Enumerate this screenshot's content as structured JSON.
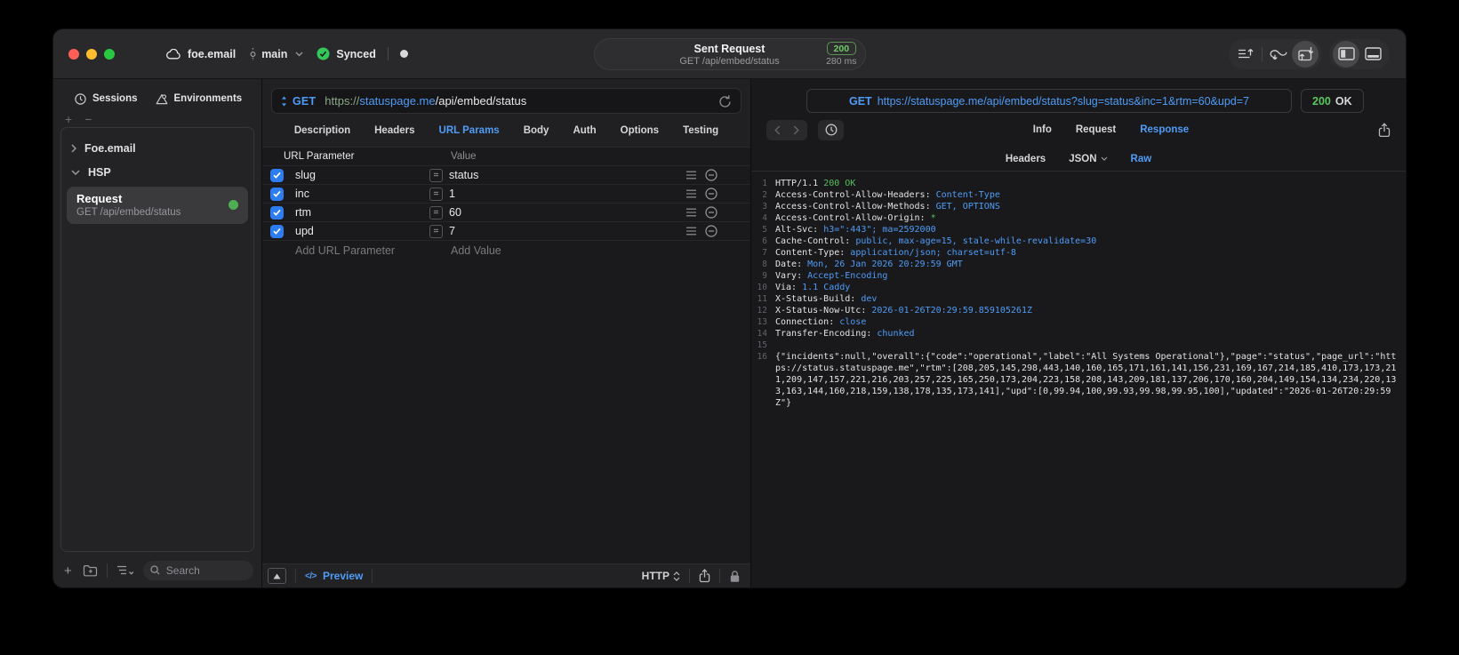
{
  "titlebar": {
    "project": "foe.email",
    "branch": "main",
    "sync_status": "Synced",
    "request": {
      "title": "Sent Request",
      "subtitle": "GET /api/embed/status",
      "status_code": "200",
      "duration": "280 ms"
    }
  },
  "sidebar": {
    "tabs": [
      "Sessions",
      "Environments"
    ],
    "groups": [
      {
        "label": "Foe.email"
      },
      {
        "label": "HSP"
      }
    ],
    "request_item": {
      "title": "Request",
      "subtitle": "GET /api/embed/status"
    },
    "search_placeholder": "Search"
  },
  "request": {
    "method": "GET",
    "url_scheme": "https://",
    "url_host": "statuspage.me",
    "url_path": "/api/embed/status",
    "tabs": [
      "Description",
      "Headers",
      "URL Params",
      "Body",
      "Auth",
      "Options",
      "Testing"
    ],
    "active_tab": "URL Params",
    "params": {
      "columns": [
        "URL Parameter",
        "Value"
      ],
      "rows": [
        {
          "name": "slug",
          "value": "status",
          "enabled": true
        },
        {
          "name": "inc",
          "value": "1",
          "enabled": true
        },
        {
          "name": "rtm",
          "value": "60",
          "enabled": true
        },
        {
          "name": "upd",
          "value": "7",
          "enabled": true
        }
      ],
      "add_name": "Add URL Parameter",
      "add_value": "Add Value"
    },
    "footer": {
      "preview": "Preview",
      "protocol": "HTTP"
    }
  },
  "response": {
    "method": "GET",
    "url": "https://statuspage.me/api/embed/status?slug=status&inc=1&rtm=60&upd=7",
    "status_code": "200",
    "status_text": "OK",
    "tabs": [
      "Info",
      "Request",
      "Response"
    ],
    "active_tab": "Response",
    "subtabs": [
      "Headers",
      "JSON",
      "Raw"
    ],
    "active_subtab": "Raw",
    "lines": [
      {
        "n": 1,
        "parts": [
          {
            "t": "p",
            "s": "HTTP/1.1 "
          },
          {
            "t": "g",
            "s": "200 OK"
          }
        ]
      },
      {
        "n": 2,
        "parts": [
          {
            "t": "p",
            "s": "Access-Control-Allow-Headers: "
          },
          {
            "t": "b",
            "s": "Content-Type"
          }
        ]
      },
      {
        "n": 3,
        "parts": [
          {
            "t": "p",
            "s": "Access-Control-Allow-Methods: "
          },
          {
            "t": "b",
            "s": "GET, OPTIONS"
          }
        ]
      },
      {
        "n": 4,
        "parts": [
          {
            "t": "p",
            "s": "Access-Control-Allow-Origin: "
          },
          {
            "t": "g",
            "s": "*"
          }
        ]
      },
      {
        "n": 5,
        "parts": [
          {
            "t": "p",
            "s": "Alt-Svc: "
          },
          {
            "t": "b",
            "s": "h3=\":443\"; ma=2592000"
          }
        ]
      },
      {
        "n": 6,
        "parts": [
          {
            "t": "p",
            "s": "Cache-Control: "
          },
          {
            "t": "b",
            "s": "public, max-age=15, stale-while-revalidate=30"
          }
        ]
      },
      {
        "n": 7,
        "parts": [
          {
            "t": "p",
            "s": "Content-Type: "
          },
          {
            "t": "b",
            "s": "application/json; charset=utf-8"
          }
        ]
      },
      {
        "n": 8,
        "parts": [
          {
            "t": "p",
            "s": "Date: "
          },
          {
            "t": "b",
            "s": "Mon, 26 Jan 2026 20:29:59 GMT"
          }
        ]
      },
      {
        "n": 9,
        "parts": [
          {
            "t": "p",
            "s": "Vary: "
          },
          {
            "t": "b",
            "s": "Accept-Encoding"
          }
        ]
      },
      {
        "n": 10,
        "parts": [
          {
            "t": "p",
            "s": "Via: "
          },
          {
            "t": "b",
            "s": "1.1 Caddy"
          }
        ]
      },
      {
        "n": 11,
        "parts": [
          {
            "t": "p",
            "s": "X-Status-Build: "
          },
          {
            "t": "b",
            "s": "dev"
          }
        ]
      },
      {
        "n": 12,
        "parts": [
          {
            "t": "p",
            "s": "X-Status-Now-Utc: "
          },
          {
            "t": "b",
            "s": "2026-01-26T20:29:59.859105261Z"
          }
        ]
      },
      {
        "n": 13,
        "parts": [
          {
            "t": "p",
            "s": "Connection: "
          },
          {
            "t": "b",
            "s": "close"
          }
        ]
      },
      {
        "n": 14,
        "parts": [
          {
            "t": "p",
            "s": "Transfer-Encoding: "
          },
          {
            "t": "b",
            "s": "chunked"
          }
        ]
      },
      {
        "n": 15,
        "parts": []
      },
      {
        "n": 16,
        "parts": [
          {
            "t": "p",
            "s": "{\"incidents\":null,\"overall\":{\"code\":\"operational\",\"label\":\"All Systems Operational\"},\"page\":\"status\",\"page_url\":\"https://status.statuspage.me\",\"rtm\":[208,205,145,298,443,140,160,165,171,161,141,156,231,169,167,214,185,410,173,173,211,209,147,157,221,216,203,257,225,165,250,173,204,223,158,208,143,209,181,137,206,170,160,204,149,154,134,234,220,133,163,144,160,218,159,138,178,135,173,141],\"upd\":[0,99.94,100,99.93,99.98,99.95,100],\"updated\":\"2026-01-26T20:29:59Z\"}"
          }
        ]
      }
    ]
  },
  "icons": {
    "eq": "=",
    "code": "</>",
    "plus": "+",
    "minus": "−"
  },
  "colors": {
    "accent_blue": "#4f9cf7",
    "status_green": "#5dc560",
    "checkbox_blue": "#2d7cf0",
    "traffic_red": "#ff5f57",
    "traffic_yellow": "#febc2e",
    "traffic_green": "#28c840"
  }
}
